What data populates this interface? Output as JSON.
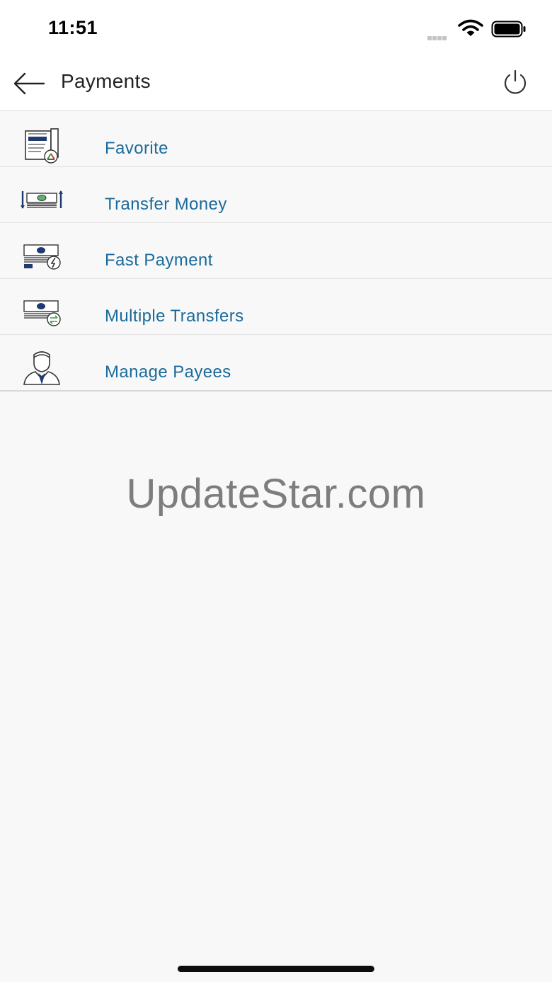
{
  "status_bar": {
    "time": "11:51"
  },
  "header": {
    "title": "Payments"
  },
  "menu": {
    "items": [
      {
        "label": "Favorite",
        "icon": "favorite-document-icon"
      },
      {
        "label": "Transfer Money",
        "icon": "transfer-money-icon"
      },
      {
        "label": "Fast Payment",
        "icon": "fast-payment-icon"
      },
      {
        "label": "Multiple Transfers",
        "icon": "multiple-transfers-icon"
      },
      {
        "label": "Manage Payees",
        "icon": "payee-person-icon"
      }
    ]
  },
  "watermark": "UpdateStar.com",
  "colors": {
    "label": "#1b6a9a",
    "icon_navy": "#1f3a6e",
    "background": "#f8f8f8"
  }
}
